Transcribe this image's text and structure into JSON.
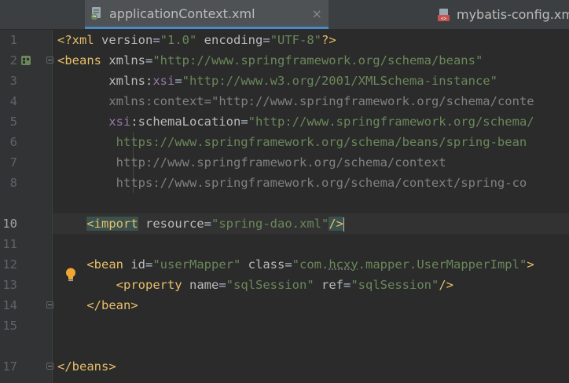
{
  "tabs": [
    {
      "label": "applicationContext.xml",
      "active": true,
      "close": "×"
    },
    {
      "label": "mybatis-config.xml",
      "active": false
    }
  ],
  "gutter": {
    "line_numbers": [
      "1",
      "2",
      "3",
      "4",
      "5",
      "6",
      "7",
      "8",
      "",
      "10",
      "11",
      "12",
      "13",
      "14",
      "15",
      "",
      "17"
    ],
    "current_line": "10"
  },
  "code": {
    "l1": {
      "open": "<?",
      "name": "xml",
      "a1": " version",
      "eq1": "=",
      "v1": "\"1.0\"",
      "a2": " encoding",
      "eq2": "=",
      "v2": "\"UTF-8\"",
      "close": "?>"
    },
    "l2": {
      "tag": "<beans",
      "a": " xmlns",
      "eq": "=",
      "v": "\"http://www.springframework.org/schema/beans\""
    },
    "l3": {
      "indent": "       ",
      "pre": "xmlns:",
      "ns": "xsi",
      "eq": "=",
      "v": "\"http://www.w3.org/2001/XMLSchema-instance\""
    },
    "l4": {
      "indent": "       ",
      "a": "xmlns:context",
      "eq": "=",
      "v": "\"http://www.springframework.org/schema/conte"
    },
    "l5": {
      "indent": "       ",
      "ns": "xsi",
      "colon": ":",
      "a": "schemaLocation",
      "eq": "=",
      "v": "\"http://www.springframework.org/schema/"
    },
    "l6": {
      "indent": "        ",
      "v": "https://www.springframework.org/schema/beans/spring-bean"
    },
    "l7": {
      "indent": "        ",
      "v": "http://www.springframework.org/schema/context"
    },
    "l8": {
      "indent": "        ",
      "v": "https://www.springframework.org/schema/context/spring-co"
    },
    "l10": {
      "indent": "    ",
      "tag": "<import",
      "a": " resource",
      "eq": "=",
      "v": "\"spring-dao.xml\"",
      "close": "/>"
    },
    "l12": {
      "indent": "    ",
      "tag": "<bean",
      "a1": " id",
      "eq1": "=",
      "v1": "\"userMapper\"",
      "a2": " class",
      "eq2": "=",
      "v2a": "\"com.",
      "v2b": "hcxy",
      "v2c": ".mapper.UserMapperImpl\"",
      "close": ">"
    },
    "l13": {
      "indent": "        ",
      "tag": "<property",
      "a1": " name",
      "eq1": "=",
      "v1": "\"sqlSession\"",
      "a2": " ref",
      "eq2": "=",
      "v2": "\"sqlSession\"",
      "close": "/>"
    },
    "l14": {
      "indent": "    ",
      "tag": "</bean>"
    },
    "l17": {
      "tag": "</beans>"
    }
  },
  "colors": {
    "background": "#2b2b2b",
    "tag": "#e8bf6a",
    "string": "#6a8759",
    "namespace": "#9876aa"
  }
}
